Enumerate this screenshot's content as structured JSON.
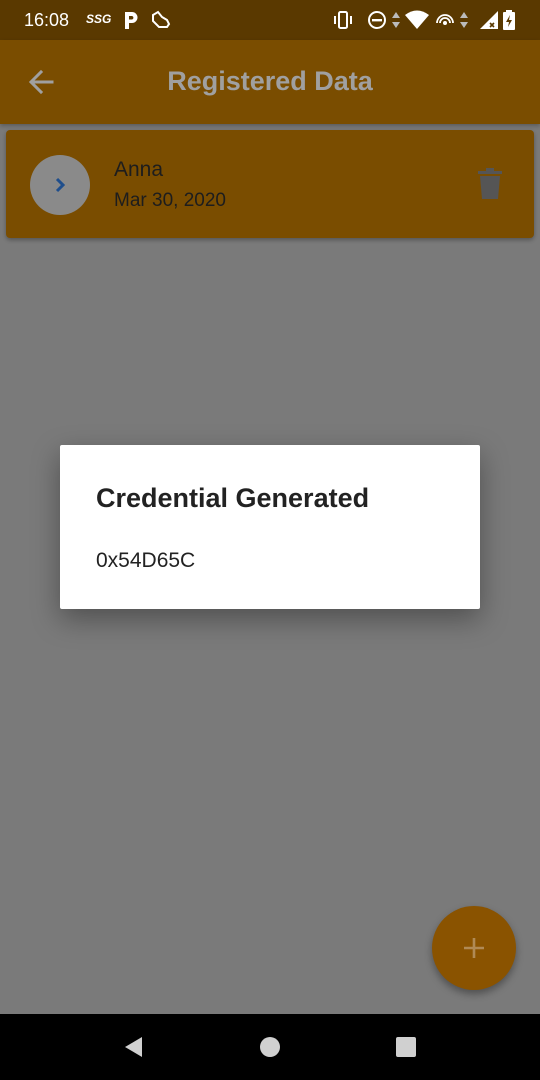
{
  "status_bar": {
    "time": "16:08",
    "carrier": "SSG",
    "left_icons": [
      "parking-icon",
      "shoe-icon"
    ],
    "right_icons": [
      "vibrate-icon",
      "do-not-disturb-icon",
      "data-arrows-icon",
      "wifi-icon",
      "hotspot-icon",
      "signal-icon",
      "battery-charging-icon"
    ]
  },
  "app_bar": {
    "title": "Registered Data",
    "back_icon": "arrow-left-icon"
  },
  "list": {
    "items": [
      {
        "name": "Anna",
        "date": "Mar 30, 2020",
        "leading_icon": "chevron-right-icon",
        "trailing_icon": "trash-icon"
      }
    ]
  },
  "dialog": {
    "title": "Credential Generated",
    "body": "0x54D65C"
  },
  "fab": {
    "icon": "plus-icon"
  },
  "nav_bar": {
    "buttons": [
      "back-triangle-icon",
      "home-circle-icon",
      "recents-square-icon"
    ]
  },
  "colors": {
    "app_bar": "#7a4d00",
    "status_bar": "#5a3900",
    "scrim_background": "#7a7a7a",
    "card": "#7a4d00",
    "fab": "#8a5300",
    "dialog": "#ffffff"
  }
}
